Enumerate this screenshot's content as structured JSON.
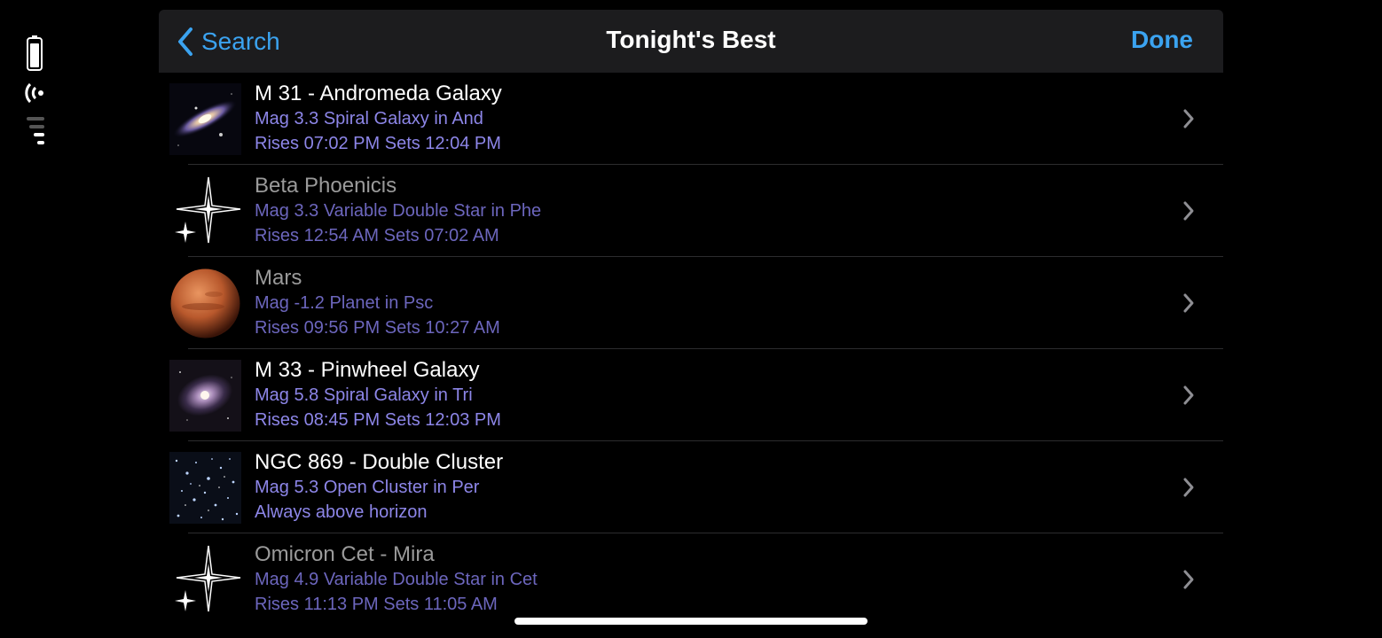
{
  "nav": {
    "back_label": "Search",
    "title": "Tonight's Best",
    "done_label": "Done"
  },
  "colors": {
    "accent": "#3ba3f0",
    "detail": "#8d86e8",
    "nav_background": "#1c1c1e",
    "background": "#000000"
  },
  "objects": [
    {
      "name": "M 31 - Andromeda Galaxy",
      "info": "Mag 3.3 Spiral Galaxy in And",
      "timing": "Rises 07:02 PM  Sets 12:04 PM",
      "icon": "galaxy-icon",
      "dim": false
    },
    {
      "name": "Beta Phoenicis",
      "info": "Mag 3.3 Variable Double Star in Phe",
      "timing": "Rises 12:54 AM  Sets 07:02 AM",
      "icon": "star-icon",
      "dim": true
    },
    {
      "name": "Mars",
      "info": "Mag -1.2 Planet in Psc",
      "timing": "Rises 09:56 PM  Sets 10:27 AM",
      "icon": "planet-icon",
      "dim": true
    },
    {
      "name": "M 33 - Pinwheel Galaxy",
      "info": "Mag 5.8 Spiral Galaxy in Tri",
      "timing": "Rises 08:45 PM  Sets 12:03 PM",
      "icon": "galaxy-icon",
      "dim": false
    },
    {
      "name": "NGC 869 - Double Cluster",
      "info": "Mag 5.3 Open Cluster in Per",
      "timing": "Always above horizon",
      "icon": "cluster-icon",
      "dim": false
    },
    {
      "name": "Omicron Cet - Mira",
      "info": "Mag 4.9 Variable Double Star in Cet",
      "timing": "Rises 11:13 PM  Sets 11:05 AM",
      "icon": "star-icon",
      "dim": true
    }
  ]
}
